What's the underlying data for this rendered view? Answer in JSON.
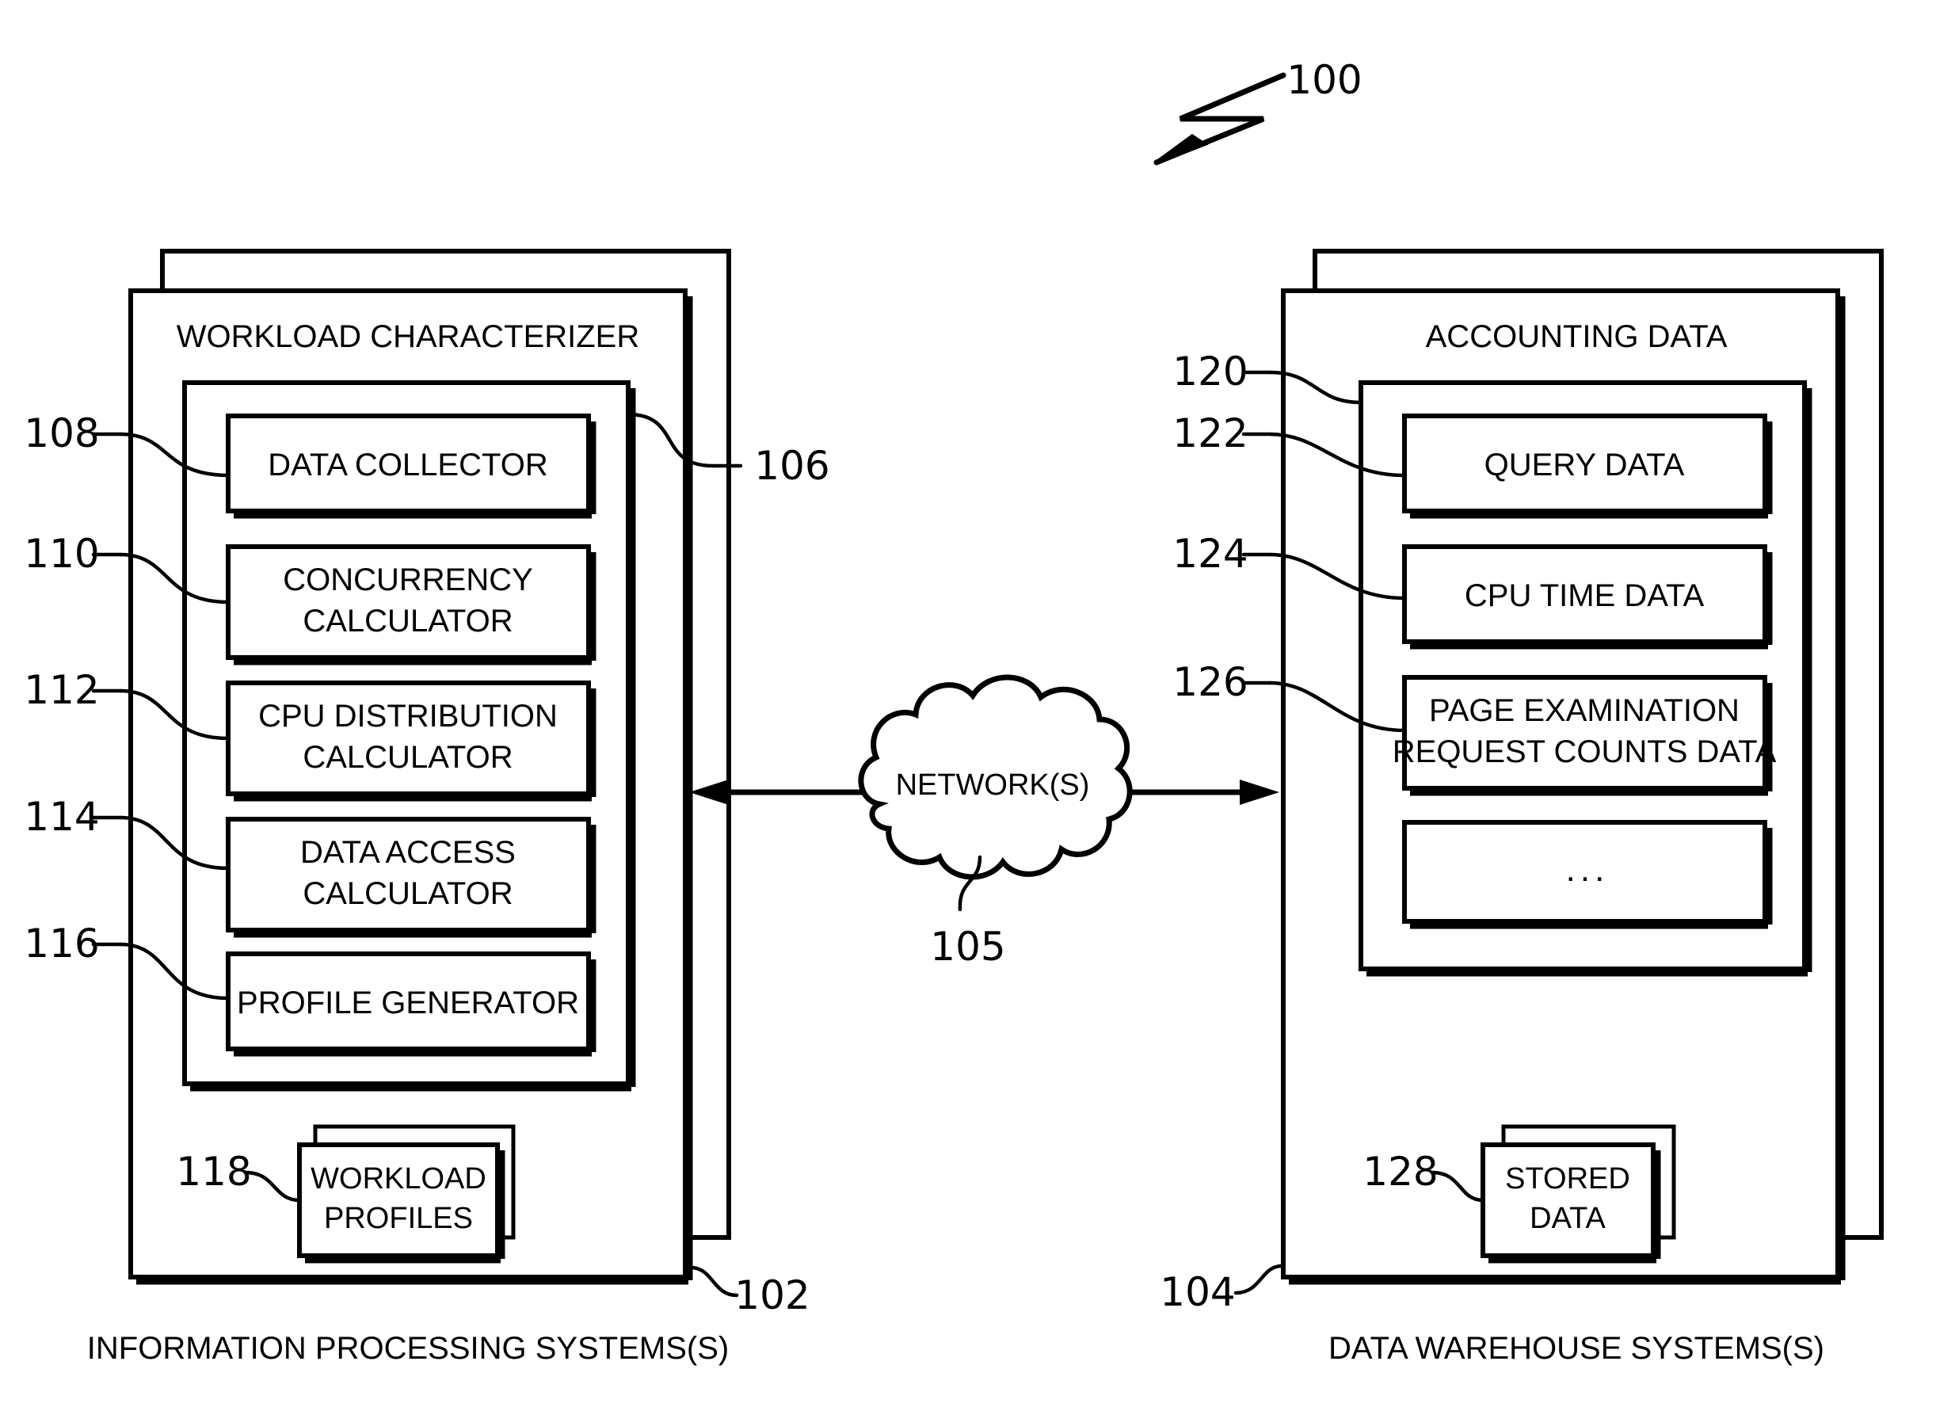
{
  "figure": {
    "figure_ref": "100",
    "network": {
      "label": "NETWORK(S)",
      "ref": "105"
    },
    "left_system": {
      "ref": "102",
      "caption": "INFORMATION PROCESSING SYSTEMS(S)",
      "inner_title": "WORKLOAD CHARACTERIZER",
      "inner_ref": "106",
      "modules": [
        {
          "label": "DATA COLLECTOR",
          "ref": "108",
          "lines": [
            "DATA COLLECTOR"
          ]
        },
        {
          "label": "CONCURRENCY CALCULATOR",
          "ref": "110",
          "lines": [
            "CONCURRENCY",
            "CALCULATOR"
          ]
        },
        {
          "label": "CPU DISTRIBUTION CALCULATOR",
          "ref": "112",
          "lines": [
            "CPU DISTRIBUTION",
            "CALCULATOR"
          ]
        },
        {
          "label": "DATA ACCESS CALCULATOR",
          "ref": "114",
          "lines": [
            "DATA ACCESS",
            "CALCULATOR"
          ]
        },
        {
          "label": "PROFILE GENERATOR",
          "ref": "116",
          "lines": [
            "PROFILE GENERATOR"
          ]
        }
      ],
      "store": {
        "ref": "118",
        "label": "WORKLOAD PROFILES",
        "lines": [
          "WORKLOAD",
          "PROFILES"
        ]
      }
    },
    "right_system": {
      "ref": "104",
      "caption": "DATA WAREHOUSE SYSTEMS(S)",
      "inner_title": "ACCOUNTING DATA",
      "inner_ref": "120",
      "modules": [
        {
          "label": "QUERY DATA",
          "ref": "122",
          "lines": [
            "QUERY DATA"
          ]
        },
        {
          "label": "CPU TIME DATA",
          "ref": "124",
          "lines": [
            "CPU TIME DATA"
          ]
        },
        {
          "label": "PAGE EXAMINATION REQUEST COUNTS DATA",
          "ref": "126",
          "lines": [
            "PAGE EXAMINATION",
            "REQUEST COUNTS DATA"
          ]
        },
        {
          "label": "...",
          "ref": "",
          "lines": [
            "..."
          ]
        }
      ],
      "store": {
        "ref": "128",
        "label": "STORED DATA",
        "lines": [
          "STORED",
          "DATA"
        ]
      }
    }
  }
}
